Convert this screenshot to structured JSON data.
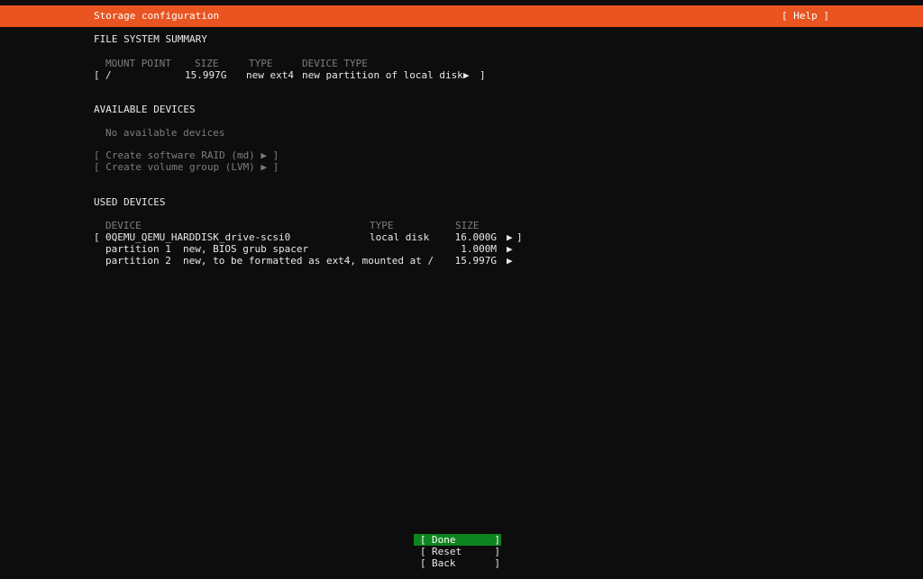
{
  "header": {
    "title": "Storage configuration",
    "help_label": "[ Help ]"
  },
  "ui": {
    "bracket_open": "[",
    "bracket_close": "]",
    "arrow": "▶"
  },
  "file_system_summary": {
    "title": "FILE SYSTEM SUMMARY",
    "columns": [
      "MOUNT POINT",
      "SIZE",
      "TYPE",
      "DEVICE TYPE"
    ],
    "row": {
      "mount_point": "/",
      "size": "15.997G",
      "type": "new ext4",
      "device_type": "new partition of local disk"
    }
  },
  "available_devices": {
    "title": "AVAILABLE DEVICES",
    "empty_message": "No available devices",
    "raid_action": "[ Create software RAID (md) ▶ ]",
    "lvm_action": "[ Create volume group (LVM) ▶ ]"
  },
  "used_devices": {
    "title": "USED DEVICES",
    "columns": [
      "DEVICE",
      "TYPE",
      "SIZE"
    ],
    "disk": {
      "name": "0QEMU_QEMU_HARDDISK_drive-scsi0",
      "type": "local disk",
      "size": "16.000G"
    },
    "partitions": [
      {
        "name": "partition 1",
        "description": "new, BIOS grub spacer",
        "size": "1.000M"
      },
      {
        "name": "partition 2",
        "description": "new, to be formatted as ext4, mounted at /",
        "size": "15.997G"
      }
    ]
  },
  "footer": {
    "buttons": [
      {
        "label": "Done",
        "selected": true
      },
      {
        "label": "Reset",
        "selected": false
      },
      {
        "label": "Back",
        "selected": false
      }
    ]
  },
  "colors": {
    "accent_orange": "#E95420",
    "selected_green": "#0E8420",
    "background": "#0d0d0d",
    "text": "#e9e9e7",
    "dim_text": "#7d7d7d"
  }
}
